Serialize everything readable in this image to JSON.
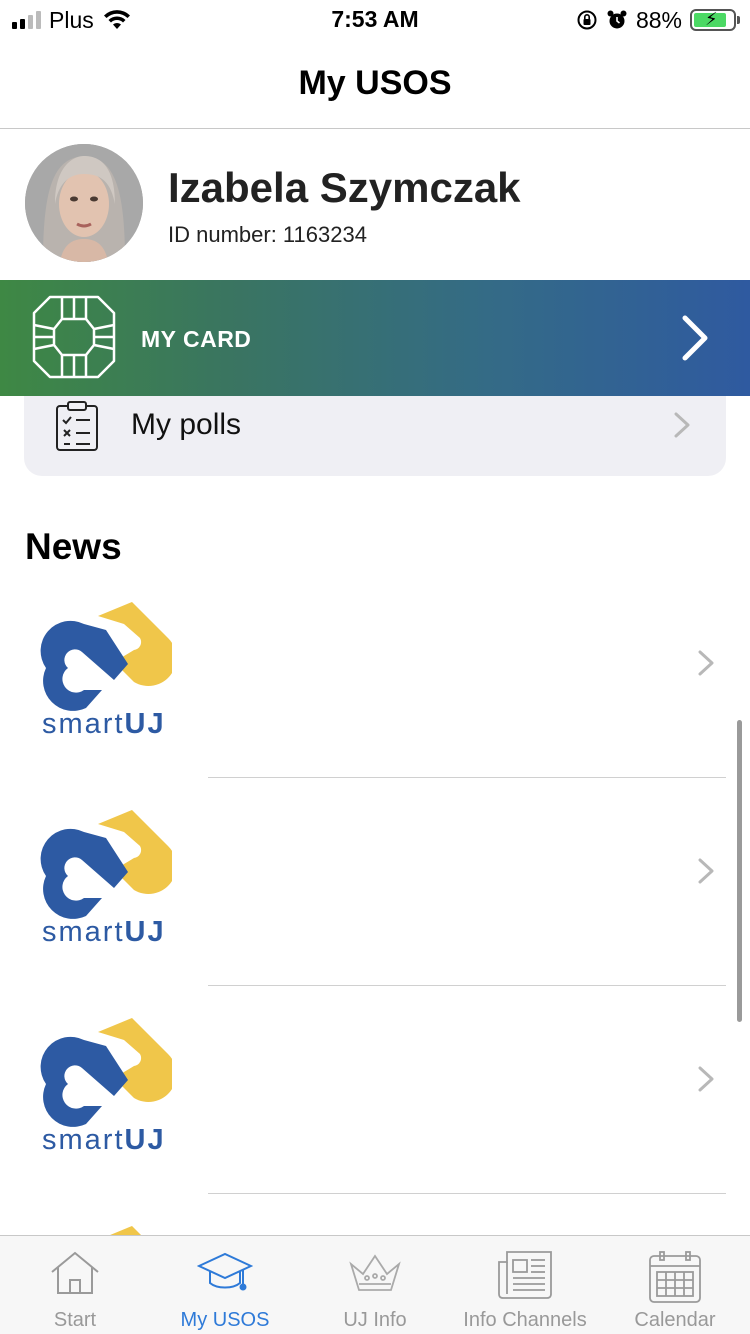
{
  "status_bar": {
    "carrier": "Plus",
    "time": "7:53 AM",
    "battery_percent": "88%",
    "icons": [
      "signal-icon",
      "wifi-icon",
      "orientation-lock-icon",
      "alarm-icon",
      "battery-charging-icon"
    ]
  },
  "navbar": {
    "title": "My USOS"
  },
  "profile": {
    "name": "Izabela Szymczak",
    "id_number": "ID number: 1163234"
  },
  "card": {
    "label": "MY CARD",
    "icon": "chip-icon"
  },
  "polls": {
    "label": "My polls",
    "icon": "checklist-icon"
  },
  "news": {
    "heading": "News",
    "items": [
      {
        "logo_text_light": "smart",
        "logo_text_bold": "UJ"
      },
      {
        "logo_text_light": "smart",
        "logo_text_bold": "UJ"
      },
      {
        "logo_text_light": "smart",
        "logo_text_bold": "UJ"
      }
    ]
  },
  "colors": {
    "accent": "#2e7ad8",
    "card_gradient_start": "#3e8844",
    "card_gradient_end": "#2f5aa0",
    "logo_blue": "#2d5aa3",
    "logo_yellow": "#f0c64a"
  },
  "tabbar": {
    "tabs": [
      {
        "label": "Start",
        "icon": "home-icon",
        "active": false
      },
      {
        "label": "My USOS",
        "icon": "graduation-cap-icon",
        "active": true
      },
      {
        "label": "UJ Info",
        "icon": "crown-icon",
        "active": false
      },
      {
        "label": "Info Channels",
        "icon": "newspaper-icon",
        "active": false
      },
      {
        "label": "Calendar",
        "icon": "calendar-icon",
        "active": false
      }
    ]
  }
}
